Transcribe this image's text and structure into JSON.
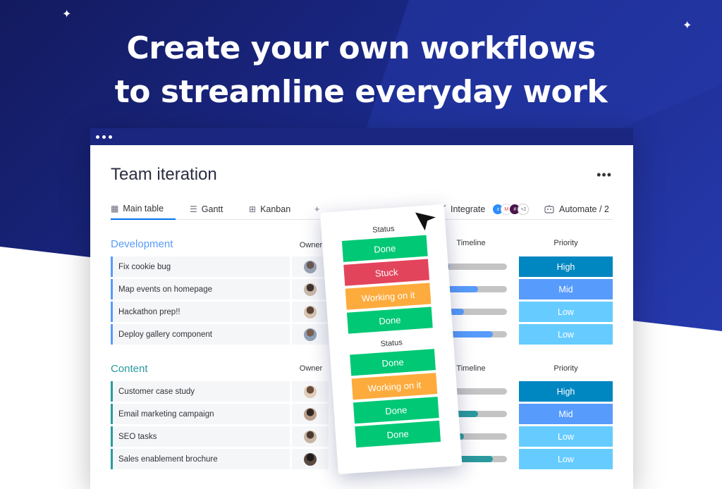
{
  "headline": {
    "line1": "Create your own workflows",
    "line2": "to streamline everyday work"
  },
  "board": {
    "title": "Team iteration",
    "menu": "•••"
  },
  "tabs": [
    {
      "label": "Main table",
      "icon": "table-icon",
      "glyph": "▦"
    },
    {
      "label": "Gantt",
      "icon": "gantt-icon",
      "glyph": "☰"
    },
    {
      "label": "Kanban",
      "icon": "kanban-icon",
      "glyph": "⊞"
    },
    {
      "label": "+",
      "icon": "add-icon",
      "glyph": ""
    }
  ],
  "toolbar": {
    "integrate_label": "Integrate",
    "integrations_more": "+2",
    "automate_label": "Automate / 2"
  },
  "columns": {
    "owner": "Owner",
    "timeline": "Timeline",
    "priority": "Priority"
  },
  "groups": [
    {
      "title": "Development",
      "color": "#579bfc",
      "rows": [
        {
          "name": "Fix cookie bug",
          "priority": "High",
          "timeline": 0.2
        },
        {
          "name": "Map events on homepage",
          "priority": "Mid",
          "timeline": 0.6
        },
        {
          "name": "Hackathon prep!!",
          "priority": "Low",
          "timeline": 0.4
        },
        {
          "name": "Deploy gallery component",
          "priority": "Low",
          "timeline": 0.8
        }
      ]
    },
    {
      "title": "Content",
      "color": "#2b9a9e",
      "rows": [
        {
          "name": "Customer case study",
          "priority": "High",
          "timeline": 0.1
        },
        {
          "name": "Email marketing campaign",
          "priority": "Mid",
          "timeline": 0.6
        },
        {
          "name": "SEO tasks",
          "priority": "Low",
          "timeline": 0.4
        },
        {
          "name": "Sales enablement brochure",
          "priority": "Low",
          "timeline": 0.8
        }
      ]
    }
  ],
  "status_popup": {
    "group1_header": "Status",
    "group1": [
      "Done",
      "Stuck",
      "Working on it",
      "Done"
    ],
    "group2_header": "Status",
    "group2": [
      "Done",
      "Working on it",
      "Done",
      "Done"
    ]
  },
  "colors": {
    "done": "#00c875",
    "stuck": "#e2445c",
    "working": "#fdab3d",
    "high": "#0086c0",
    "mid": "#579bfc",
    "low": "#66ccff",
    "accent": "#0073ea"
  }
}
